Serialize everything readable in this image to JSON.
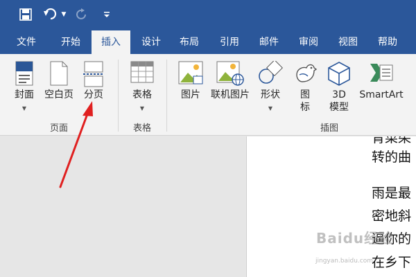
{
  "quick_access": {
    "save_icon": "save-icon",
    "undo_icon": "undo-icon",
    "redo_icon": "redo-icon",
    "customize_icon": "customize-qat-icon"
  },
  "tabs": [
    "文件",
    "开始",
    "插入",
    "设计",
    "布局",
    "引用",
    "邮件",
    "审阅",
    "视图",
    "帮助"
  ],
  "active_tab": "插入",
  "ribbon": {
    "pages_group": {
      "label": "页面",
      "cover": "封面",
      "blank_page": "空白页",
      "page_break": "分页"
    },
    "tables_group": {
      "label": "表格",
      "table": "表格"
    },
    "illustrations_group": {
      "label": "插图",
      "pictures": "图片",
      "online_pictures": "联机图片",
      "shapes": "形状",
      "icons_line1": "图",
      "icons_line2": "标",
      "models_line1": "3D",
      "models_line2": "模型",
      "smartart": "SmartArt"
    }
  },
  "document": {
    "lines": [
      "转的曲",
      "雨是最",
      "密地斜",
      "逼你的",
      "在乡下"
    ]
  },
  "watermark": {
    "brand": "Baidu经验",
    "url": "jingyan.baidu.com"
  },
  "colors": {
    "ribbon_blue": "#2b579a",
    "ribbon_bg": "#f3f3f3",
    "arrow_red": "#e02020"
  }
}
